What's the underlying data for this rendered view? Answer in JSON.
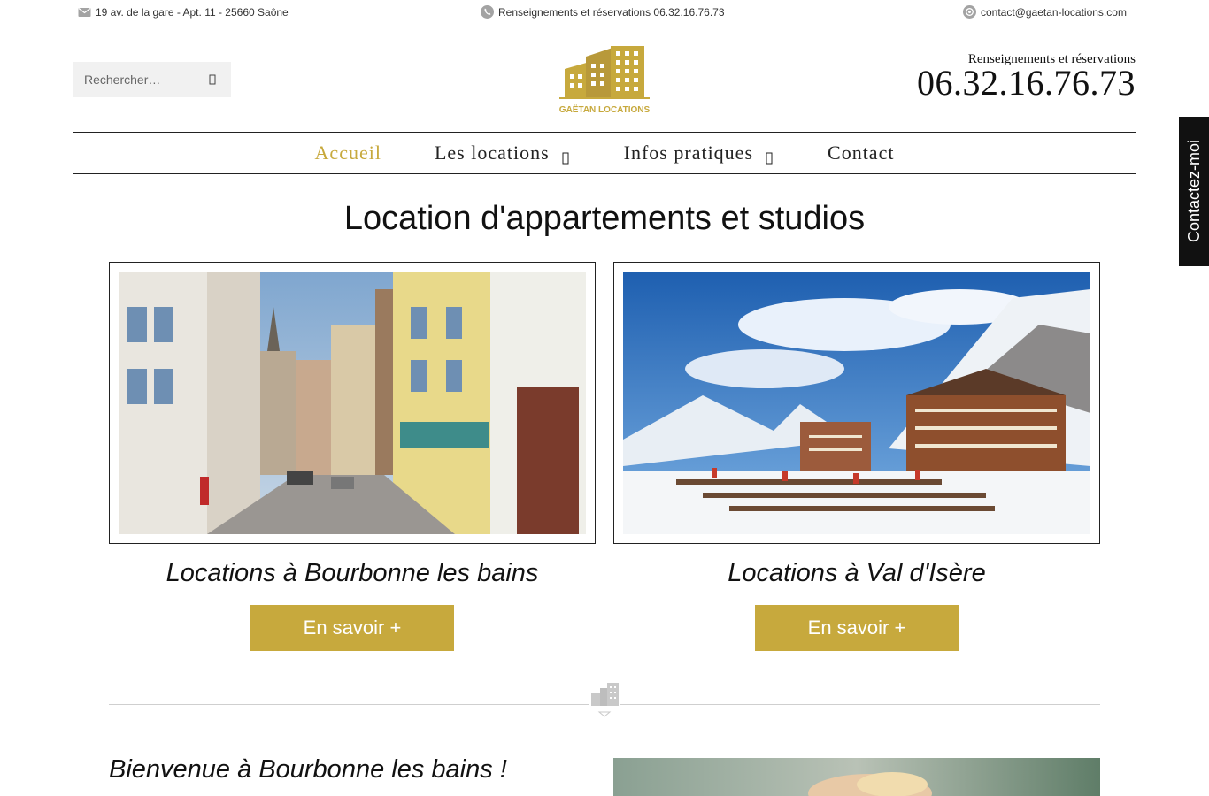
{
  "topbar": {
    "address": "19 av. de la gare - Apt. 11 - 25660 Saône",
    "phone_text": "Renseignements et réservations 06.32.16.76.73",
    "email": "contact@gaetan-locations.com",
    "address_icon": "envelope-icon",
    "phone_icon": "phone-icon",
    "email_icon": "at-icon"
  },
  "header": {
    "search_placeholder": "Rechercher…",
    "logo_text": "GAËTAN LOCATIONS",
    "phone_label": "Renseignements et réservations",
    "phone_number": "06.32.16.76.73"
  },
  "nav": {
    "items": [
      {
        "label": "Accueil",
        "active": true
      },
      {
        "label": "Les locations",
        "has_dropdown": true
      },
      {
        "label": "Infos pratiques",
        "has_dropdown": true
      },
      {
        "label": "Contact"
      }
    ]
  },
  "main": {
    "title": "Location d'appartements et studios",
    "cards": [
      {
        "caption": "Locations à Bourbonne les bains",
        "button": "En savoir +"
      },
      {
        "caption": "Locations à Val d'Isère",
        "button": "En savoir +"
      }
    ],
    "welcome_title": "Bienvenue à Bourbonne les bains !"
  },
  "side_tab": {
    "label": "Contactez-moi"
  },
  "colors": {
    "accent": "#c7a93d",
    "dark": "#111111"
  }
}
